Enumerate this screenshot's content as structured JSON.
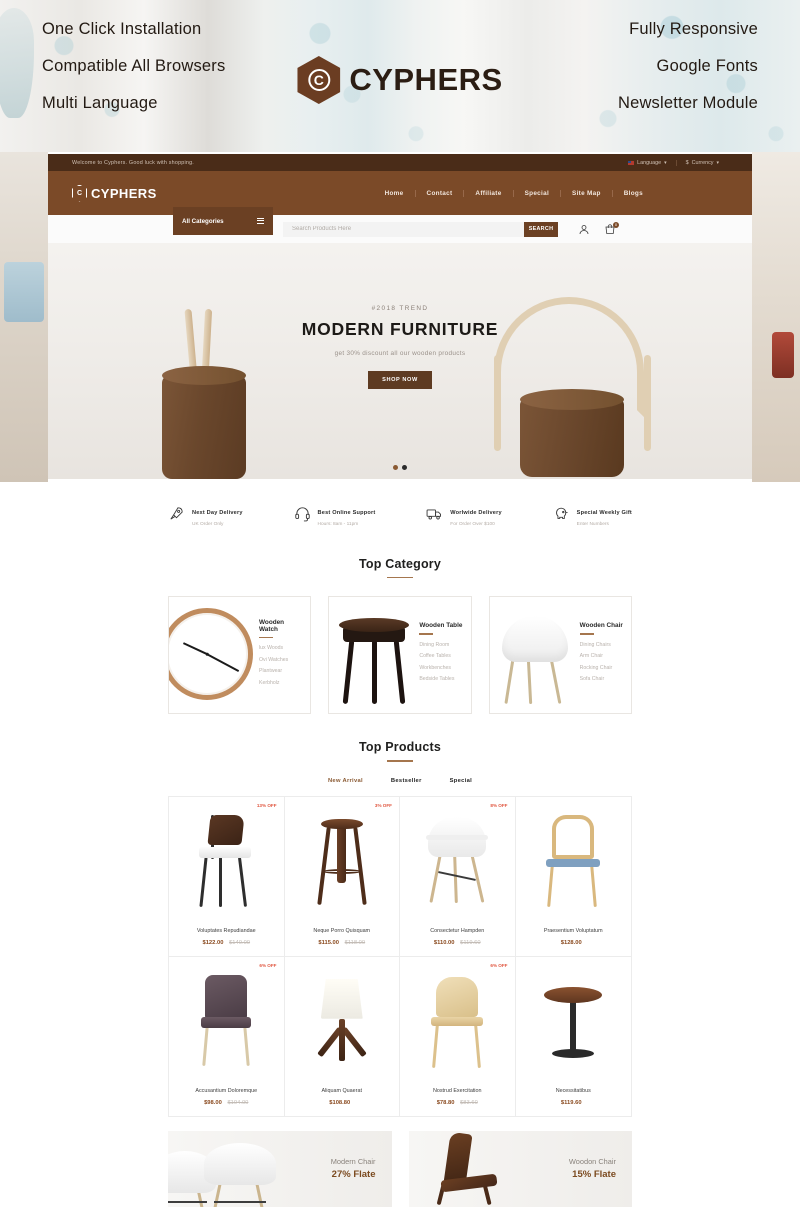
{
  "promo": {
    "left_features": [
      "One Click Installation",
      "Compatible All Browsers",
      "Multi Language"
    ],
    "right_features": [
      "Fully Responsive",
      "Google Fonts",
      "Newsletter Module"
    ],
    "logo_letter": "C",
    "logo_text": "CYPHERS",
    "accent_brown": "#6b3d22"
  },
  "topbar": {
    "welcome": "Welcome to Cyphers. Good luck with shopping.",
    "language_label": "Language",
    "currency_label": "Currency",
    "currency_symbol": "$",
    "caret": "▾"
  },
  "header": {
    "brand_letter": "C",
    "brand_text": "CYPHERS",
    "nav": [
      {
        "label": "Home"
      },
      {
        "label": "Contact"
      },
      {
        "label": "Affiliate"
      },
      {
        "label": "Special"
      },
      {
        "label": "Site Map"
      },
      {
        "label": "Blogs"
      }
    ]
  },
  "search": {
    "all_categories_label": "All Categories",
    "placeholder": "Search Products Here",
    "value": "",
    "button_label": "SEARCH",
    "cart_count": "0"
  },
  "hero": {
    "kicker": "#2018 TREND",
    "title": "MODERN FURNITURE",
    "subtitle": "get 30% discount all our wooden products",
    "button_label": "SHOP NOW",
    "slides": 2,
    "active_slide": 1
  },
  "services": [
    {
      "icon": "rocket-icon",
      "title": "Next Day Delivery",
      "sub": "UK Order Only"
    },
    {
      "icon": "headset-icon",
      "title": "Best Online Support",
      "sub": "Hours: 8am - 11pm"
    },
    {
      "icon": "truck-icon",
      "title": "Worlwide Delivery",
      "sub": "For Order Over $100"
    },
    {
      "icon": "piggybank-icon",
      "title": "Special Weekly Gift",
      "sub": "Enter Numbers"
    }
  ],
  "top_category": {
    "title": "Top Category",
    "cards": [
      {
        "name": "Wooden Watch",
        "links": [
          "lux Woods",
          "Ovi Watches",
          "Plantwear",
          "Kerbholz"
        ]
      },
      {
        "name": "Wooden Table",
        "links": [
          "Dining Room",
          "Coffee Tables",
          "Workbenches",
          "Bedside Tables"
        ]
      },
      {
        "name": "Wooden Chair",
        "links": [
          "Dining Chairs",
          "Arm Chair",
          "Rocking Chair",
          "Sofa Chair"
        ]
      }
    ]
  },
  "top_products": {
    "title": "Top Products",
    "tabs": [
      {
        "label": "New Arrival",
        "active": true
      },
      {
        "label": "Bestseller",
        "active": false
      },
      {
        "label": "Special",
        "active": false
      }
    ],
    "items": [
      {
        "name": "Voluptates Repudiandae",
        "price": "$122.00",
        "old_price": "$140.00",
        "badge": "13% OFF",
        "art": "art-chair-brown"
      },
      {
        "name": "Neque Porro Quisquam",
        "price": "$115.00",
        "old_price": "$118.00",
        "badge": "3% OFF",
        "art": "art-stool"
      },
      {
        "name": "Consectetur Hampden",
        "price": "$110.00",
        "old_price": "$119.60",
        "badge": "8% OFF",
        "art": "art-eames"
      },
      {
        "name": "Praesentium Voluptatum",
        "price": "$128.00",
        "old_price": "",
        "badge": "",
        "art": "art-woodchair"
      },
      {
        "name": "Accusantium Doloremque",
        "price": "$98.00",
        "old_price": "$104.00",
        "badge": "6% OFF",
        "art": "art-purple"
      },
      {
        "name": "Aliquam Quaerat",
        "price": "$108.80",
        "old_price": "",
        "badge": "",
        "art": "art-lamp"
      },
      {
        "name": "Nostrud Exercitation",
        "price": "$78.80",
        "old_price": "$83.60",
        "badge": "6% OFF",
        "art": "art-plywood"
      },
      {
        "name": "Necessitatibus",
        "price": "$119.60",
        "old_price": "",
        "badge": "",
        "art": "art-round"
      }
    ]
  },
  "bottom_promos": [
    {
      "name": "Modern Chair",
      "offer": "27% Flate"
    },
    {
      "name": "Woodon Chair",
      "offer": "15% Flate"
    }
  ]
}
